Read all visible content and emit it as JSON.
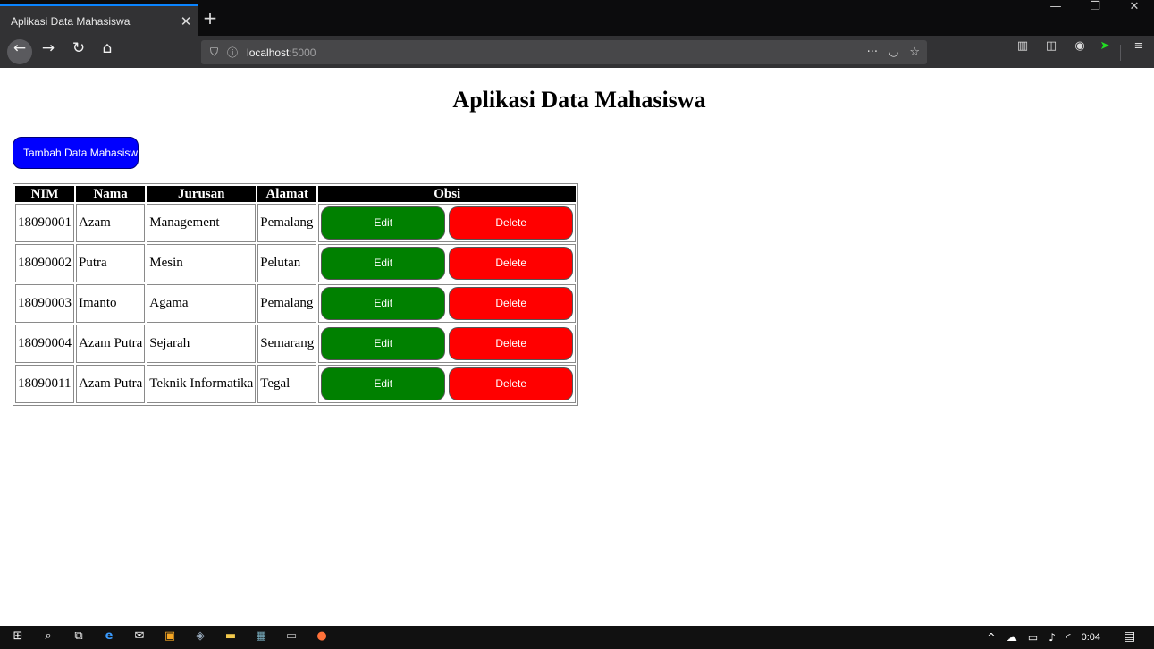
{
  "browser": {
    "tab_title": "Aplikasi Data Mahasiswa",
    "tab_close": "✕",
    "new_tab": "+",
    "url_host": "localhost",
    "url_port": ":5000",
    "window_minimize": "—",
    "window_restore": "❐",
    "window_close": "✕"
  },
  "page": {
    "title": "Aplikasi Data Mahasiswa",
    "add_button_label": "Tambah Data Mahasiswa"
  },
  "table": {
    "headers": [
      "NIM",
      "Nama",
      "Jurusan",
      "Alamat",
      "Obsi"
    ],
    "rows": [
      {
        "nim": "18090001",
        "nama": "Azam",
        "jurusan": "Management",
        "alamat": "Pemalang"
      },
      {
        "nim": "18090002",
        "nama": "Putra",
        "jurusan": "Mesin",
        "alamat": "Pelutan"
      },
      {
        "nim": "18090003",
        "nama": "Imanto",
        "jurusan": "Agama",
        "alamat": "Pemalang"
      },
      {
        "nim": "18090004",
        "nama": "Azam Putra",
        "jurusan": "Sejarah",
        "alamat": "Semarang"
      },
      {
        "nim": "18090011",
        "nama": "Azam Putra",
        "jurusan": "Teknik Informatika",
        "alamat": "Tegal"
      }
    ],
    "edit_label": "Edit",
    "delete_label": "Delete"
  },
  "colors": {
    "add_button": "#0000ff",
    "edit_button": "#008000",
    "delete_button": "#ff0000",
    "header_bg": "#000000"
  },
  "taskbar": {
    "clock": "0:04"
  }
}
